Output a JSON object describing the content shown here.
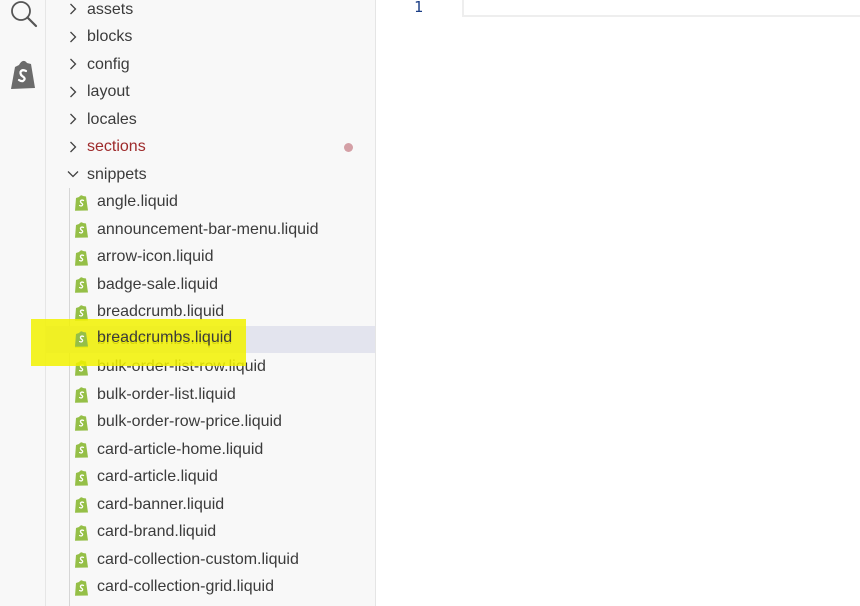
{
  "activity_bar": {
    "icons": [
      "search-icon",
      "shopify-icon"
    ]
  },
  "explorer": {
    "folders": [
      {
        "label": "assets",
        "expanded": false
      },
      {
        "label": "blocks",
        "expanded": false
      },
      {
        "label": "config",
        "expanded": false
      },
      {
        "label": "layout",
        "expanded": false
      },
      {
        "label": "locales",
        "expanded": false
      },
      {
        "label": "sections",
        "expanded": false,
        "modified": true
      },
      {
        "label": "snippets",
        "expanded": true
      }
    ],
    "snippet_files": [
      "angle.liquid",
      "announcement-bar-menu.liquid",
      "arrow-icon.liquid",
      "badge-sale.liquid",
      "breadcrumb.liquid",
      "breadcrumbs.liquid",
      "bulk-order-list-row.liquid",
      "bulk-order-list.liquid",
      "bulk-order-row-price.liquid",
      "card-article-home.liquid",
      "card-article.liquid",
      "card-banner.liquid",
      "card-brand.liquid",
      "card-collection-custom.liquid",
      "card-collection-grid.liquid"
    ],
    "selected_file": "breadcrumbs.liquid"
  },
  "editor": {
    "line_number": "1"
  },
  "colors": {
    "modified_text": "#9e2a2b",
    "highlight": "#f2f200",
    "liquid_icon": "#95bf47",
    "selection": "#e3e4ee"
  }
}
